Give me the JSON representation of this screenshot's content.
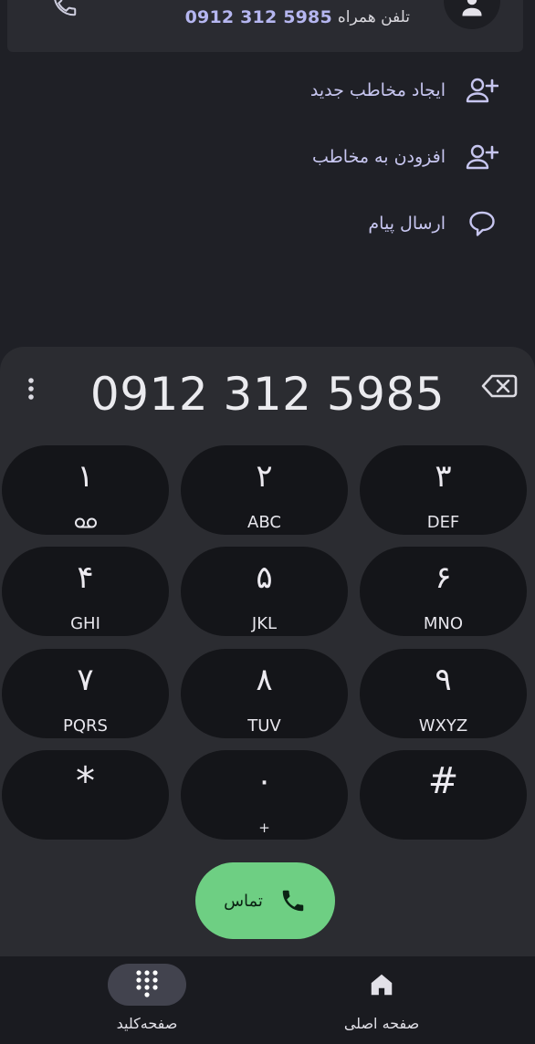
{
  "contact": {
    "label": "تلفن همراه",
    "number": "0912 312 5985"
  },
  "actions": [
    {
      "label": "ایجاد مخاطب جدید",
      "icon": "add-person-icon"
    },
    {
      "label": "افزودن به مخاطب",
      "icon": "add-person-icon"
    },
    {
      "label": "ارسال پیام",
      "icon": "message-bubble-icon"
    }
  ],
  "dialer": {
    "number": "0912 312 5985",
    "keys": [
      {
        "digit": "۱",
        "letters": ""
      },
      {
        "digit": "۲",
        "letters": "ABC"
      },
      {
        "digit": "۳",
        "letters": "DEF"
      },
      {
        "digit": "۴",
        "letters": "GHI"
      },
      {
        "digit": "۵",
        "letters": "JKL"
      },
      {
        "digit": "۶",
        "letters": "MNO"
      },
      {
        "digit": "۷",
        "letters": "PQRS"
      },
      {
        "digit": "۸",
        "letters": "TUV"
      },
      {
        "digit": "۹",
        "letters": "WXYZ"
      },
      {
        "digit": "*",
        "letters": ""
      },
      {
        "digit": "۰",
        "letters": "+"
      },
      {
        "digit": "#",
        "letters": ""
      }
    ],
    "call_label": "تماس"
  },
  "nav": {
    "keypad_label": "صفحه‌کلید",
    "home_label": "صفحه اصلی"
  },
  "colors": {
    "background": "#1f2026",
    "sheet": "#2b2c31",
    "key": "#141519",
    "accent": "#b5b6f0",
    "call_green": "#6ecf83"
  }
}
